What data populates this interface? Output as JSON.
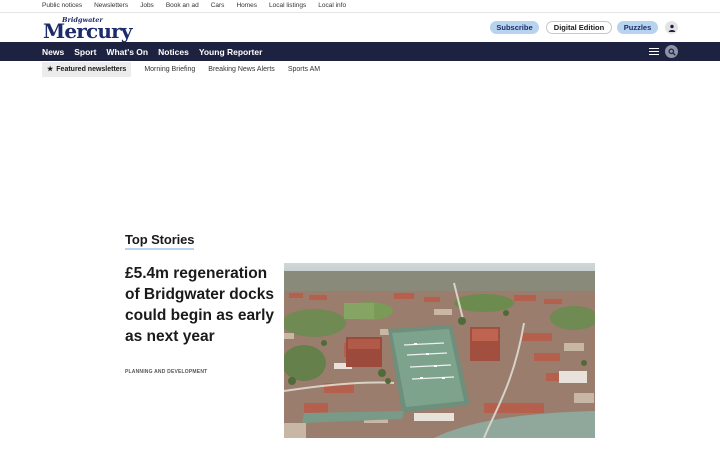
{
  "utility_nav": [
    "Public notices",
    "Newsletters",
    "Jobs",
    "Book an ad",
    "Cars",
    "Homes",
    "Local listings",
    "Local info"
  ],
  "masthead": {
    "logo_small": "Bridgwater",
    "logo_big": "Mercury",
    "subscribe": "Subscribe",
    "digital_edition": "Digital Edition",
    "puzzles": "Puzzles",
    "account_icon": "user-icon"
  },
  "main_nav": [
    "News",
    "Sport",
    "What's On",
    "Notices",
    "Young Reporter"
  ],
  "nav_icons": {
    "menu": "hamburger-icon",
    "search": "search-icon"
  },
  "newsletters": {
    "featured": "Featured newsletters",
    "links": [
      "Morning Briefing",
      "Breaking News Alerts",
      "Sports AM"
    ]
  },
  "top_stories": {
    "heading": "Top Stories",
    "lead": {
      "headline": "£5.4m regeneration of Bridgwater docks could begin as early as next year",
      "category": "PLANNING AND DEVELOPMENT"
    }
  },
  "colors": {
    "navy": "#1d2240",
    "brand_blue": "#1c2c6b",
    "pill_blue": "#b7d3ee"
  }
}
